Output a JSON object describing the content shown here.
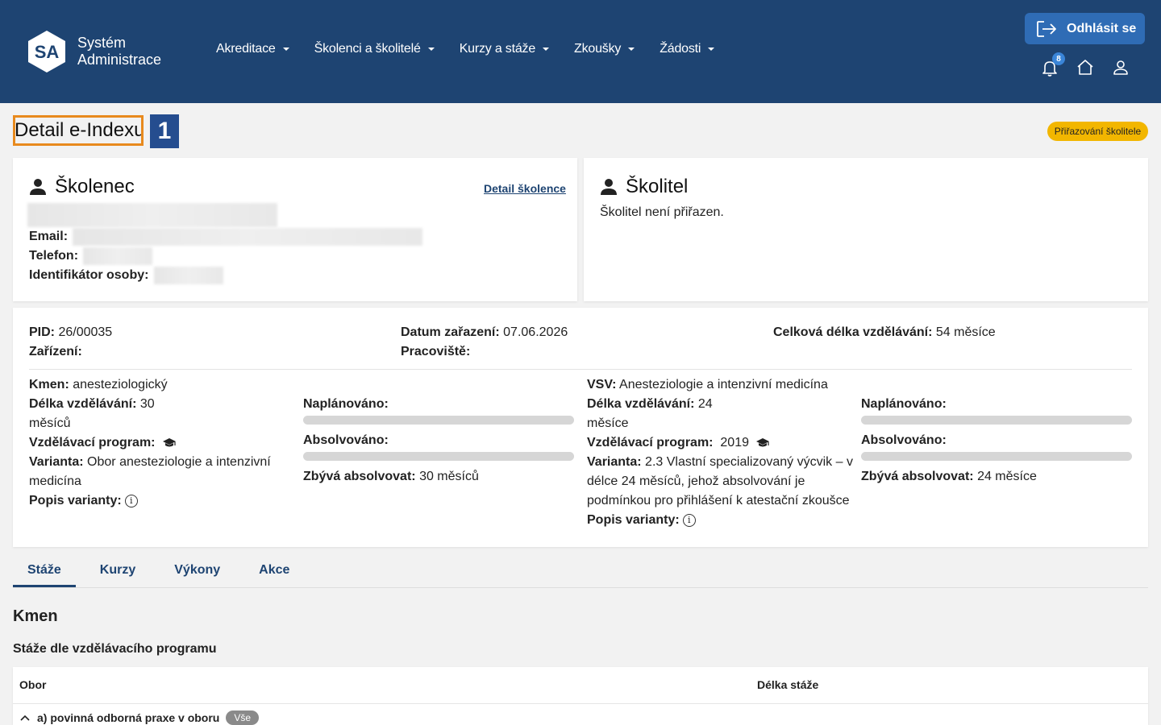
{
  "brand": {
    "logo_text": "SA",
    "name_line1": "Systém",
    "name_line2": "Administrace"
  },
  "nav": [
    {
      "label": "Akreditace"
    },
    {
      "label": "Školenci a školitelé"
    },
    {
      "label": "Kurzy a stáže"
    },
    {
      "label": "Zkoušky"
    },
    {
      "label": "Žádosti"
    }
  ],
  "header": {
    "logout_label": "Odhlásit se",
    "notification_count": "8"
  },
  "page": {
    "title": "Detail e-Indexu",
    "step_number": "1",
    "status": "Přiřazování školitele"
  },
  "trainee": {
    "heading": "Školenec",
    "detail_link": "Detail školence",
    "email_label": "Email:",
    "phone_label": "Telefon:",
    "id_label": "Identifikátor osoby:"
  },
  "trainer": {
    "heading": "Školitel",
    "status_text": "Školitel není přiřazen."
  },
  "summary": {
    "pid_label": "PID:",
    "pid_value": "26/00035",
    "facility_label": "Zařízení:",
    "date_label": "Datum zařazení:",
    "date_value": "07.06.2026",
    "workplace_label": "Pracoviště:",
    "total_label": "Celková délka vzdělávání:",
    "total_value": "54 měsíce"
  },
  "kmen": {
    "name_label": "Kmen:",
    "name_value": "anesteziologický",
    "length_label": "Délka vzdělávání:",
    "length_value": "30",
    "length_unit": "měsíců",
    "program_label": "Vzdělávací program:",
    "variant_label": "Varianta:",
    "variant_value": "Obor anesteziologie a intenzivní",
    "variant_value_2": "medicína",
    "desc_label": "Popis varianty:",
    "planned_label": "Naplánováno:",
    "planned_progress": 0,
    "completed_label": "Absolvováno:",
    "completed_progress": 0,
    "remaining_label": "Zbývá absolvovat:",
    "remaining_value": "30 měsíců"
  },
  "vsv": {
    "name_label": "VSV:",
    "name_value": "Anesteziologie a intenzivní medicína",
    "length_label": "Délka vzdělávání:",
    "length_value": "24",
    "length_unit": "měsíce",
    "program_label": "Vzdělávací program:",
    "program_value": "2019",
    "variant_label": "Varianta:",
    "variant_value": "2.3 Vlastní specializovaný výcvik – v",
    "variant_value_2": "délce 24 měsíců, jehož absolvování je",
    "variant_value_3": "podmínkou pro přihlášení k atestační zkoušce",
    "desc_label": "Popis varianty:",
    "planned_label": "Naplánováno:",
    "planned_progress": 0,
    "completed_label": "Absolvováno:",
    "completed_progress": 0,
    "remaining_label": "Zbývá absolvovat:",
    "remaining_value": "24 měsíce"
  },
  "tabs": [
    {
      "label": "Stáže"
    },
    {
      "label": "Kurzy"
    },
    {
      "label": "Výkony"
    },
    {
      "label": "Akce"
    }
  ],
  "section": {
    "title": "Kmen",
    "subtitle": "Stáže dle vzdělávacího programu"
  },
  "table": {
    "col_obor": "Obor",
    "col_length": "Délka stáže",
    "row1_label": "a) povinná odborná praxe v oboru",
    "row1_pill": "Vše"
  },
  "colors": {
    "header_bg": "#1e4472",
    "accent": "#2f6cb5",
    "status_pill": "#f2b600",
    "highlight": "#e88a1e"
  }
}
